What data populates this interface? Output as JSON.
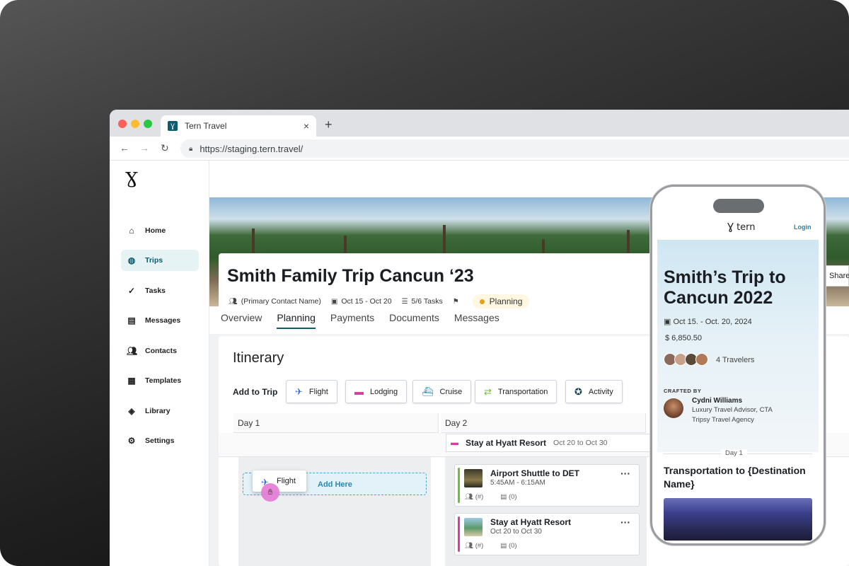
{
  "browser": {
    "tab_title": "Tern Travel",
    "url": "https://staging.tern.travel/"
  },
  "sidebar": {
    "items": [
      {
        "label": "Home",
        "icon": "home-icon"
      },
      {
        "label": "Trips",
        "icon": "globe-icon"
      },
      {
        "label": "Tasks",
        "icon": "check-circle-icon"
      },
      {
        "label": "Messages",
        "icon": "message-icon"
      },
      {
        "label": "Contacts",
        "icon": "people-icon"
      },
      {
        "label": "Templates",
        "icon": "template-icon"
      },
      {
        "label": "Library",
        "icon": "layers-icon"
      },
      {
        "label": "Settings",
        "icon": "gear-icon"
      }
    ]
  },
  "trip": {
    "title": "Smith Family Trip Cancun ‘23",
    "contact": "(Primary Contact Name)",
    "dates": "Oct 15 - Oct 20",
    "tasks": "5/6 Tasks",
    "status": "Planning"
  },
  "tabs": [
    "Overview",
    "Planning",
    "Payments",
    "Documents",
    "Messages"
  ],
  "itinerary": {
    "title": "Itinerary",
    "add_label": "Add to Trip",
    "buttons": [
      "Flight",
      "Lodging",
      "Cruise",
      "Transportation",
      "Activity"
    ],
    "days": [
      "Day 1",
      "Day 2"
    ],
    "stay_banner": {
      "title": "Stay at Hyatt Resort",
      "dates": "Oct 20 to Oct 30"
    },
    "drag_chip": "Flight",
    "drop_label": "Add Here",
    "cards": [
      {
        "title": "Airport Shuttle to DET",
        "sub": "5:45AM - 6:15AM",
        "travelers": "(#)",
        "comments": "(0)"
      },
      {
        "title": "Stay at Hyatt Resort",
        "sub": "Oct 20 to Oct 30",
        "travelers": "(#)",
        "comments": "(0)"
      }
    ]
  },
  "share_label": "Share",
  "phone": {
    "brand": "tern",
    "login": "Login",
    "title": "Smith’s Trip to Cancun 2022",
    "dates": "Oct 15. - Oct. 20, 2024",
    "price": "$  6,850.50",
    "travelers": "4 Travelers",
    "crafted_by": "CRAFTED BY",
    "advisor_name": "Cydni  Williams",
    "advisor_role": "Luxury Travel Advisor, CTA",
    "advisor_agency": "Tripsy Travel Agency",
    "day_label": "Day 1",
    "section_title": "Transportation to {Destination Name}"
  },
  "colors": {
    "accent": "#0d5c6e",
    "status_dot": "#e2a21b",
    "flight": "#3b6fd8",
    "lodging": "#d63fa1",
    "cruise": "#1f8fb3",
    "transport": "#6cbf3a",
    "activity": "#0d3b4a"
  }
}
